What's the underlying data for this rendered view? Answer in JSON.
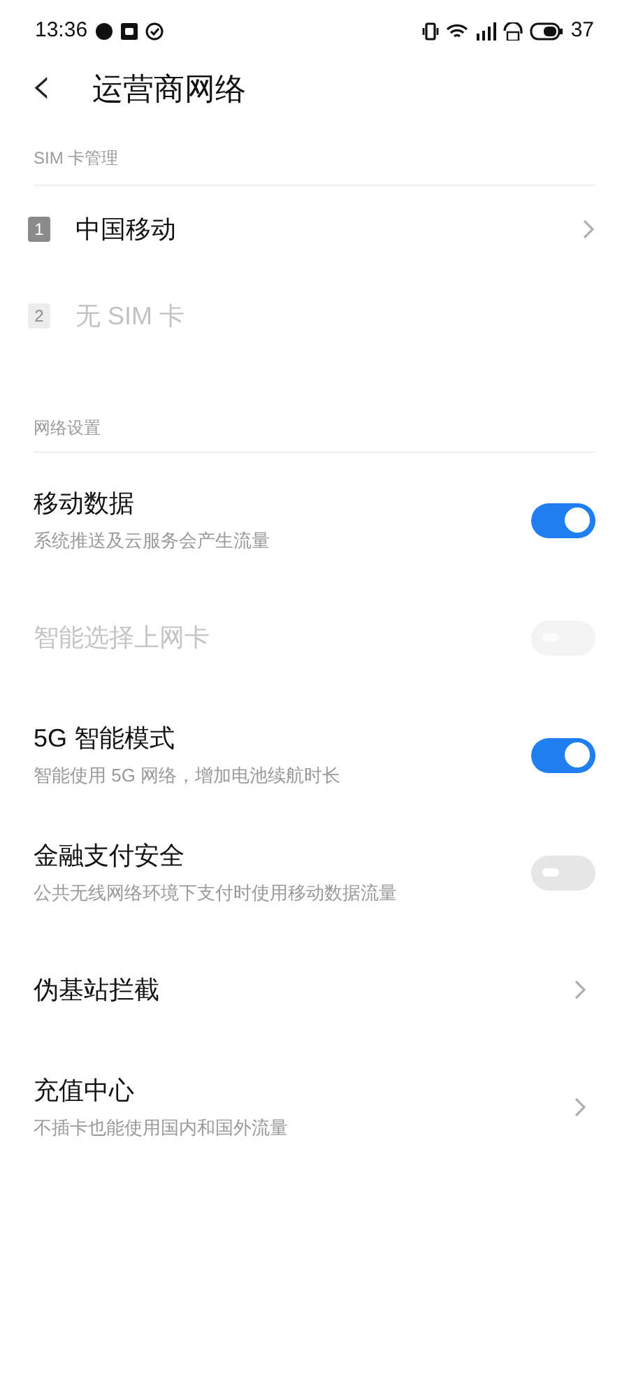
{
  "status_bar": {
    "time": "13:36",
    "battery": "37"
  },
  "header": {
    "back": "‹",
    "title": "运营商网络"
  },
  "sim_section": {
    "label": "SIM 卡管理",
    "cards": [
      {
        "badge": "1",
        "name": "中国移动",
        "disabled": false,
        "has_arrow": true
      },
      {
        "badge": "2",
        "name": "无 SIM 卡",
        "disabled": true,
        "has_arrow": false
      }
    ]
  },
  "network_section": {
    "label": "网络设置",
    "items": [
      {
        "kind": "toggle",
        "title": "移动数据",
        "subtitle": "系统推送及云服务会产生流量",
        "on": true,
        "disabled": false
      },
      {
        "kind": "toggle",
        "title": "智能选择上网卡",
        "on": false,
        "disabled": true
      },
      {
        "kind": "toggle",
        "title": "5G 智能模式",
        "subtitle": "智能使用 5G 网络，增加电池续航时长",
        "on": true,
        "disabled": false
      },
      {
        "kind": "toggle",
        "title": "金融支付安全",
        "subtitle": "公共无线网络环境下支付时使用移动数据流量",
        "on": false,
        "disabled": false
      },
      {
        "kind": "link",
        "title": "伪基站拦截",
        "disabled": false
      },
      {
        "kind": "link",
        "title": "充值中心",
        "subtitle": "不插卡也能使用国内和国外流量",
        "disabled": false
      }
    ]
  }
}
